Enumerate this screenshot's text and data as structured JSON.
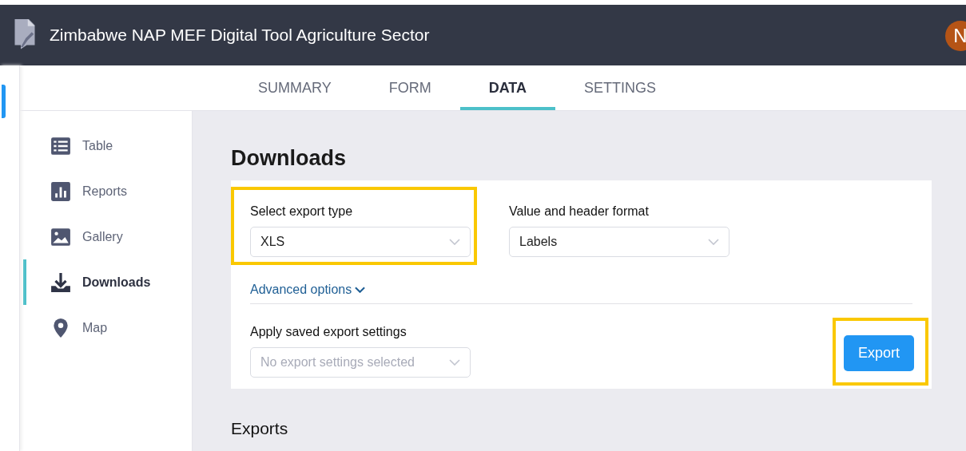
{
  "header": {
    "title": "Zimbabwe NAP MEF Digital Tool Agriculture Sector",
    "avatar": "N"
  },
  "tabs": [
    {
      "label": "SUMMARY",
      "selected": false
    },
    {
      "label": "FORM",
      "selected": false
    },
    {
      "label": "DATA",
      "selected": true
    },
    {
      "label": "SETTINGS",
      "selected": false
    }
  ],
  "sidebar": {
    "items": [
      {
        "label": "Table",
        "selected": false
      },
      {
        "label": "Reports",
        "selected": false
      },
      {
        "label": "Gallery",
        "selected": false
      },
      {
        "label": "Downloads",
        "selected": true
      },
      {
        "label": "Map",
        "selected": false
      }
    ]
  },
  "downloads": {
    "title": "Downloads",
    "fields": [
      {
        "label": "Select export type",
        "value": "XLS",
        "highlighted": true
      },
      {
        "label": "Value and header format",
        "value": "Labels",
        "highlighted": false
      }
    ],
    "advanced_options": "Advanced options",
    "saved_settings": {
      "label": "Apply saved export settings",
      "placeholder": "No export settings selected"
    },
    "export_button": {
      "label": "Export",
      "highlighted": true
    }
  },
  "exports_title": "Exports"
}
